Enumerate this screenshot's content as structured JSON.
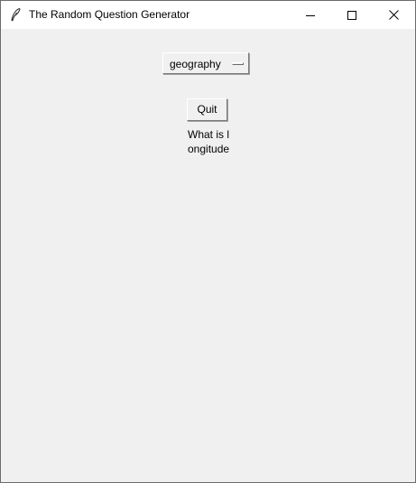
{
  "window": {
    "title": "The Random Question Generator",
    "controls": {
      "minimize": "minimize-icon",
      "maximize": "maximize-icon",
      "close": "close-icon"
    }
  },
  "category_menu": {
    "selected": "geography",
    "indicator_icon": "option-menu-indicator-icon"
  },
  "quit_button": {
    "label": "Quit"
  },
  "question": {
    "text": "What is longitude"
  },
  "colors": {
    "window_background": "#f0f0f0",
    "titlebar_background": "#ffffff"
  }
}
